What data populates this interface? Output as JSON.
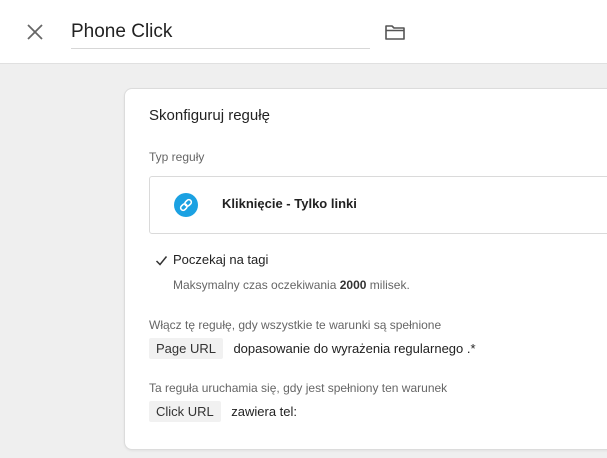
{
  "header": {
    "title": "Phone Click",
    "close_icon": "close-icon",
    "folder_icon": "folder-icon"
  },
  "card": {
    "title": "Skonfiguruj regułę",
    "trigger_type_label": "Typ reguły",
    "trigger_type": {
      "name": "Kliknięcie - Tylko linki",
      "icon": "link-icon",
      "icon_color": "#1ba1e2"
    },
    "wait_for_tags": {
      "label": "Poczekaj na tagi",
      "checked": true,
      "max_wait_prefix": "Maksymalny czas oczekiwania",
      "max_wait_value": "2000",
      "max_wait_suffix": "milisek."
    },
    "enable_section": {
      "label": "Włącz tę regułę, gdy wszystkie te warunki są spełnione",
      "variable": "Page URL",
      "condition": "dopasowanie do wyrażenia regularnego .*"
    },
    "fire_section": {
      "label": "Ta reguła uruchamia się, gdy jest spełniony ten warunek",
      "variable": "Click URL",
      "condition": "zawiera tel:"
    }
  }
}
